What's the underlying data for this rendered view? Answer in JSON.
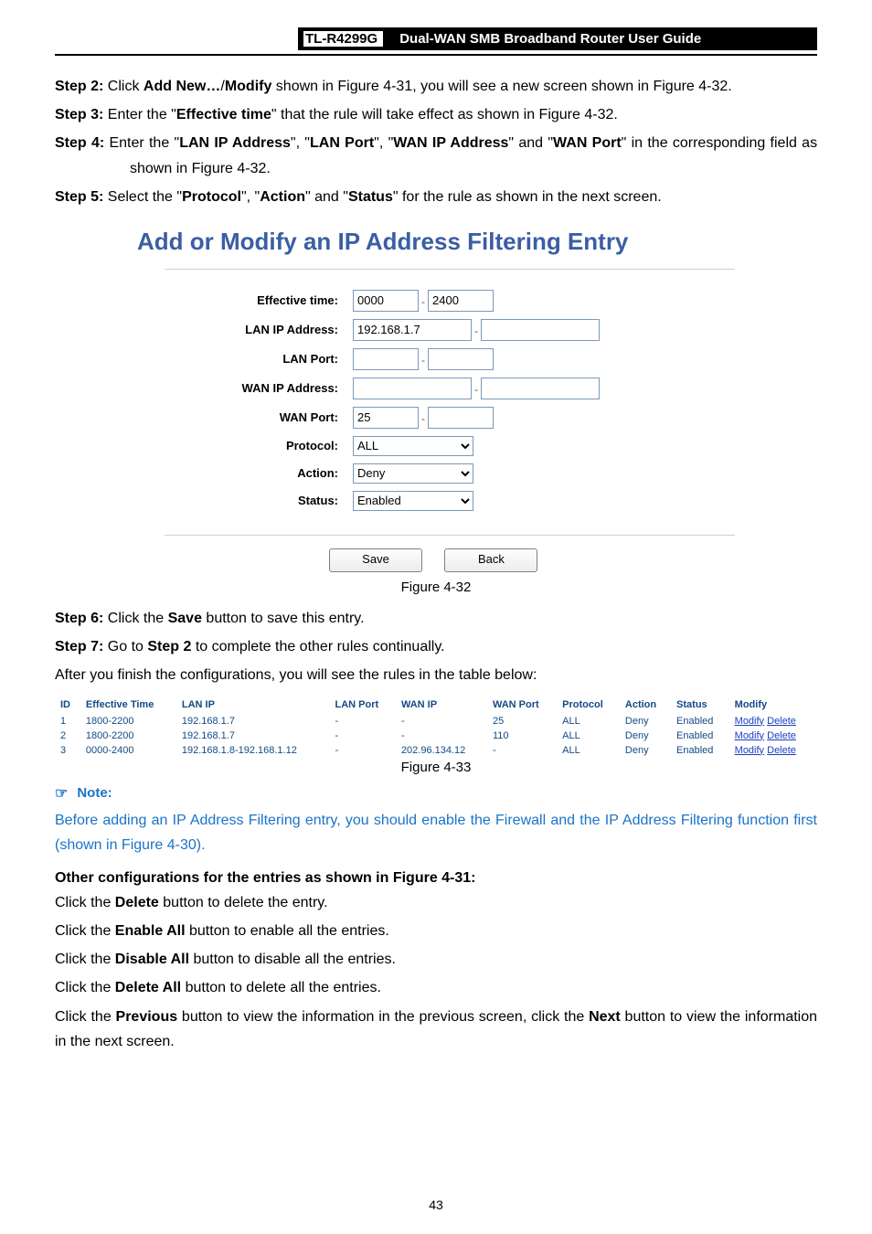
{
  "header": {
    "model": "TL-R4299G",
    "title": "Dual-WAN SMB Broadband Router User Guide"
  },
  "steps_top": [
    {
      "label": "Step 2:",
      "text_html": [
        "Click ",
        {
          "b": "Add New…"
        },
        "/",
        {
          "b": "Modify"
        },
        " shown in Figure 4-31, you will see a new screen shown in Figure 4-32."
      ]
    },
    {
      "label": "Step 3:",
      "text_html": [
        "Enter the \"",
        {
          "b": "Effective time"
        },
        "\" that the rule will take effect as shown in Figure 4-32."
      ]
    },
    {
      "label": "Step 4:",
      "text_html": [
        "Enter the \"",
        {
          "b": "LAN IP Address"
        },
        "\", \"",
        {
          "b": "LAN Port"
        },
        "\", \"",
        {
          "b": "WAN IP Address"
        },
        "\" and \"",
        {
          "b": "WAN Port"
        },
        "\" in the corresponding field as shown in Figure 4-32."
      ]
    },
    {
      "label": "Step 5:",
      "text_html": [
        "Select the \"",
        {
          "b": "Protocol"
        },
        "\", \"",
        {
          "b": "Action"
        },
        "\" and \"",
        {
          "b": "Status"
        },
        "\" for the rule as shown in the next screen."
      ]
    }
  ],
  "cfg": {
    "title": "Add or Modify an IP Address Filtering Entry",
    "rows": {
      "effective_label": "Effective time:",
      "effective_from": "0000",
      "effective_to": "2400",
      "lanip_label": "LAN IP Address:",
      "lanip_from": "192.168.1.7",
      "lanip_to": "",
      "lanport_label": "LAN Port:",
      "lanport_from": "",
      "lanport_to": "",
      "wanip_label": "WAN IP Address:",
      "wanip_from": "",
      "wanip_to": "",
      "wanport_label": "WAN Port:",
      "wanport_from": "25",
      "wanport_to": "",
      "protocol_label": "Protocol:",
      "protocol_value": "ALL",
      "action_label": "Action:",
      "action_value": "Deny",
      "status_label": "Status:",
      "status_value": "Enabled"
    },
    "buttons": {
      "save": "Save",
      "back": "Back"
    }
  },
  "figcap1": "Figure 4-32",
  "steps_after": [
    {
      "label": "Step 6:",
      "text_html": [
        "Click the ",
        {
          "b": "Save"
        },
        " button to save this entry."
      ]
    },
    {
      "label": "Step 7:",
      "text_html": [
        "Go to ",
        {
          "b": "Step 2"
        },
        " to complete the other rules continually."
      ]
    }
  ],
  "after_config_line": "After you finish the configurations, you will see the rules in the table below:",
  "rules": {
    "headers": [
      "ID",
      "Effective Time",
      "LAN IP",
      "LAN Port",
      "WAN IP",
      "WAN Port",
      "Protocol",
      "Action",
      "Status",
      "Modify"
    ],
    "rows": [
      [
        "1",
        "1800-2200",
        "192.168.1.7",
        "-",
        "-",
        "25",
        "ALL",
        "Deny",
        "Enabled",
        "Modify Delete"
      ],
      [
        "2",
        "1800-2200",
        "192.168.1.7",
        "-",
        "-",
        "110",
        "ALL",
        "Deny",
        "Enabled",
        "Modify Delete"
      ],
      [
        "3",
        "0000-2400",
        "192.168.1.8-192.168.1.12",
        "-",
        "202.96.134.12",
        "-",
        "ALL",
        "Deny",
        "Enabled",
        "Modify Delete"
      ]
    ]
  },
  "figcap2": "Figure 4-33",
  "note": {
    "label": "Note:",
    "body": "Before adding an IP Address Filtering entry, you should enable the Firewall and the IP Address Filtering function first (shown in Figure 4-30)."
  },
  "other": {
    "heading": "Other configurations for the entries as shown in Figure 4-31:",
    "lines": [
      [
        "Click the ",
        {
          "b": "Delete"
        },
        " button to delete the entry."
      ],
      [
        "Click the ",
        {
          "b": "Enable All"
        },
        " button to enable all the entries."
      ],
      [
        "Click the ",
        {
          "b": "Disable All"
        },
        " button to disable all the entries."
      ],
      [
        "Click the ",
        {
          "b": "Delete All"
        },
        " button to delete all the entries."
      ],
      [
        "Click the ",
        {
          "b": "Previous"
        },
        " button to view the information in the previous screen, click the ",
        {
          "b": "Next"
        },
        " button to view the information in the next screen."
      ]
    ]
  },
  "page_number": "43"
}
